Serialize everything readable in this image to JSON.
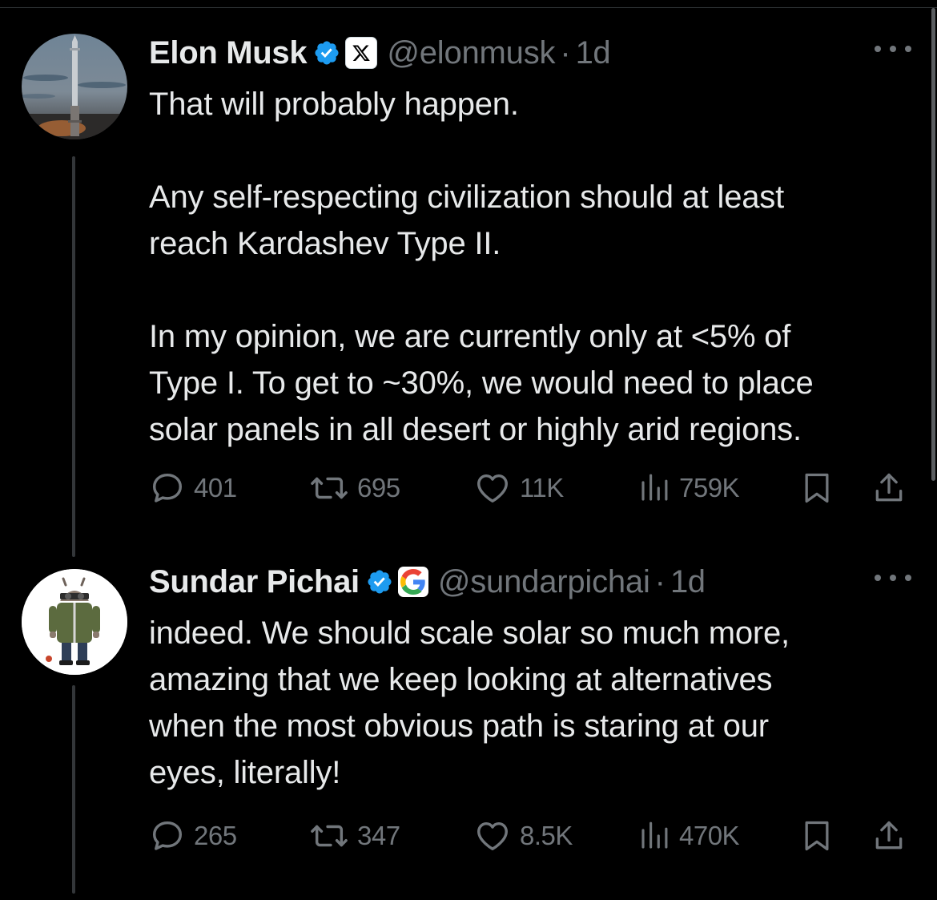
{
  "tweets": [
    {
      "name": "Elon Musk",
      "handle": "@elonmusk",
      "separator": "·",
      "time": "1d",
      "affiliation_icon": "x-logo-icon",
      "lines": [
        "That will probably happen.",
        "",
        "Any self-respecting civilization should at least",
        "reach Kardashev Type II.",
        "",
        "In my opinion, we are currently only at <5% of",
        "Type I. To get to ~30%, we would need to place",
        "solar panels in all desert or highly arid regions."
      ],
      "replies": "401",
      "reposts": "695",
      "likes": "11K",
      "views": "759K"
    },
    {
      "name": "Sundar Pichai",
      "handle": "@sundarpichai",
      "separator": "·",
      "time": "1d",
      "affiliation_icon": "google-logo-icon",
      "lines": [
        "indeed. We should scale solar so much more,",
        "amazing that we keep looking at alternatives",
        "when the most obvious path is staring at our",
        "eyes, literally!"
      ],
      "replies": "265",
      "reposts": "347",
      "likes": "8.5K",
      "views": "470K"
    }
  ],
  "colors": {
    "background": "#000000",
    "text": "#e7e9ea",
    "muted": "#71767b",
    "verified": "#1d9bf0",
    "thread_line": "#333639"
  }
}
